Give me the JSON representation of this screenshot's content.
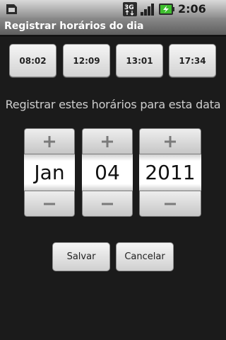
{
  "status_bar": {
    "time": "2:06 AM",
    "network_label": "3G",
    "icons": [
      "sim-card-icon",
      "3g-data-icon",
      "signal-strength-icon",
      "battery-charging-icon"
    ]
  },
  "title_bar": {
    "title": "Registrar horários do dia"
  },
  "time_buttons": [
    {
      "label": "08:02"
    },
    {
      "label": "12:09"
    },
    {
      "label": "13:01"
    },
    {
      "label": "17:34"
    }
  ],
  "prompt": "Registrar estes horários para esta data",
  "date_picker": {
    "increment_symbol": "+",
    "decrement_symbol": "−",
    "month": "Jan",
    "day": "04",
    "year": "2011"
  },
  "actions": {
    "save_label": "Salvar",
    "cancel_label": "Cancelar"
  },
  "colors": {
    "background": "#1b1b1b",
    "battery_accent": "#3fbf2f",
    "prompt_text": "#cfcfcf"
  }
}
